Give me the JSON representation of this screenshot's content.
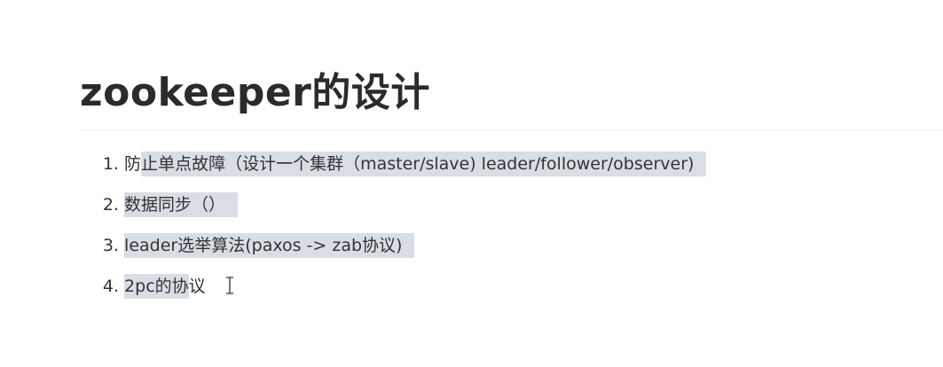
{
  "document": {
    "heading": "zookeeper的设计",
    "items": [
      {
        "number": "1.",
        "plain": "防",
        "highlighted": "止单点故障（设计一个集群（master/slave)    leader/follower/observer)"
      },
      {
        "number": "2.",
        "plain": "",
        "highlighted": "数据同步（）"
      },
      {
        "number": "3.",
        "plain": "",
        "highlighted": "leader选举算法(paxos -> zab协议)"
      },
      {
        "number": "4.",
        "plain": "",
        "highlighted": "2pc的协",
        "tail": "议"
      }
    ]
  },
  "cursor": {
    "icon": "text-cursor-icon",
    "color": "#555555"
  },
  "colors": {
    "selection": "#d9dee5",
    "text": "#333333",
    "heading": "#2b2b2b"
  }
}
